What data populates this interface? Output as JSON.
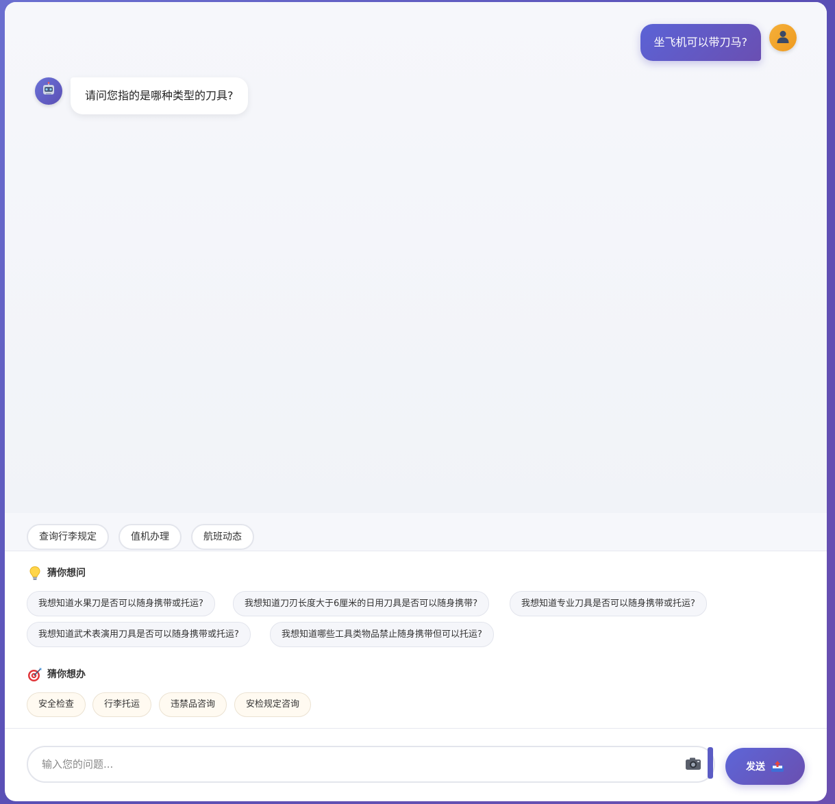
{
  "chat": {
    "messages": [
      {
        "role": "user",
        "text": "坐飞机可以带刀马?"
      },
      {
        "role": "bot",
        "text": "请问您指的是哪种类型的刀具?"
      }
    ],
    "user_avatar_icon": "user-icon",
    "bot_avatar_icon": "robot-icon"
  },
  "quick_actions": [
    "查询行李规定",
    "值机办理",
    "航班动态"
  ],
  "guess_questions": {
    "title": "猜你想问",
    "icon": "lightbulb-icon",
    "items": [
      "我想知道水果刀是否可以随身携带或托运?",
      "我想知道刀刃长度大于6厘米的日用刀具是否可以随身携带?",
      "我想知道专业刀具是否可以随身携带或托运?",
      "我想知道武术表演用刀具是否可以随身携带或托运?",
      "我想知道哪些工具类物品禁止随身携带但可以托运?"
    ]
  },
  "guess_actions": {
    "title": "猜你想办",
    "icon": "target-icon",
    "items": [
      "安全检查",
      "行李托运",
      "违禁品咨询",
      "安检规定咨询"
    ]
  },
  "input": {
    "placeholder": "输入您的问题...",
    "value": "",
    "camera_icon": "camera-icon"
  },
  "send": {
    "label": "发送",
    "icon": "send-icon"
  },
  "colors": {
    "accent": "#5b63d6",
    "accent_dark": "#6a4fb2",
    "user_avatar": "#f5a623",
    "action_chip_bg": "#fffaf1"
  }
}
